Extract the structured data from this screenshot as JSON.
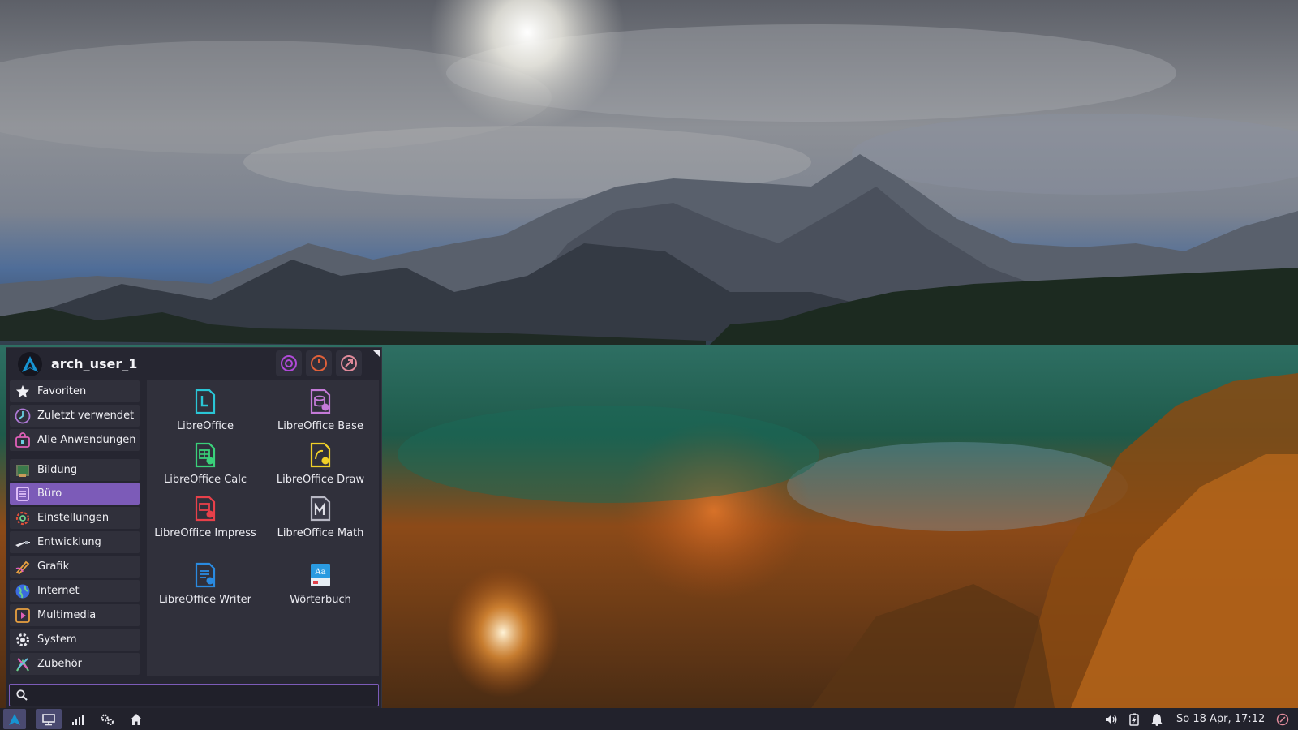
{
  "user": {
    "name": "arch_user_1"
  },
  "header_buttons": [
    {
      "icon": "lock-screen-icon"
    },
    {
      "icon": "power-icon"
    },
    {
      "icon": "logout-icon"
    }
  ],
  "categories": [
    {
      "label": "Favoriten",
      "icon": "star-icon"
    },
    {
      "label": "Zuletzt verwendet",
      "icon": "clock-icon"
    },
    {
      "label": "Alle Anwendungen",
      "icon": "all-apps-icon"
    },
    {
      "label": "Bildung",
      "icon": "education-icon"
    },
    {
      "label": "Büro",
      "icon": "office-icon",
      "active": true
    },
    {
      "label": "Einstellungen",
      "icon": "settings-icon"
    },
    {
      "label": "Entwicklung",
      "icon": "development-icon"
    },
    {
      "label": "Grafik",
      "icon": "graphics-icon"
    },
    {
      "label": "Internet",
      "icon": "internet-icon"
    },
    {
      "label": "Multimedia",
      "icon": "multimedia-icon"
    },
    {
      "label": "System",
      "icon": "system-gear-icon"
    },
    {
      "label": "Zubehör",
      "icon": "accessories-icon"
    }
  ],
  "apps": [
    {
      "label": "LibreOffice",
      "icon": "libreoffice-icon"
    },
    {
      "label": "LibreOffice Base",
      "icon": "libreoffice-base-icon"
    },
    {
      "label": "LibreOffice Calc",
      "icon": "libreoffice-calc-icon"
    },
    {
      "label": "LibreOffice Draw",
      "icon": "libreoffice-draw-icon"
    },
    {
      "label": "LibreOffice Impress",
      "icon": "libreoffice-impress-icon"
    },
    {
      "label": "LibreOffice Math",
      "icon": "libreoffice-math-icon"
    },
    {
      "label": "LibreOffice Writer",
      "icon": "libreoffice-writer-icon"
    },
    {
      "label": "Wörterbuch",
      "icon": "dictionary-icon"
    }
  ],
  "search": {
    "value": "",
    "placeholder": ""
  },
  "taskbar": {
    "clock": "So 18 Apr, 17:12"
  },
  "colors": {
    "menu_bg": "#262631",
    "accent": "#7c5bb8",
    "taskbar_bg": "#22222c"
  }
}
